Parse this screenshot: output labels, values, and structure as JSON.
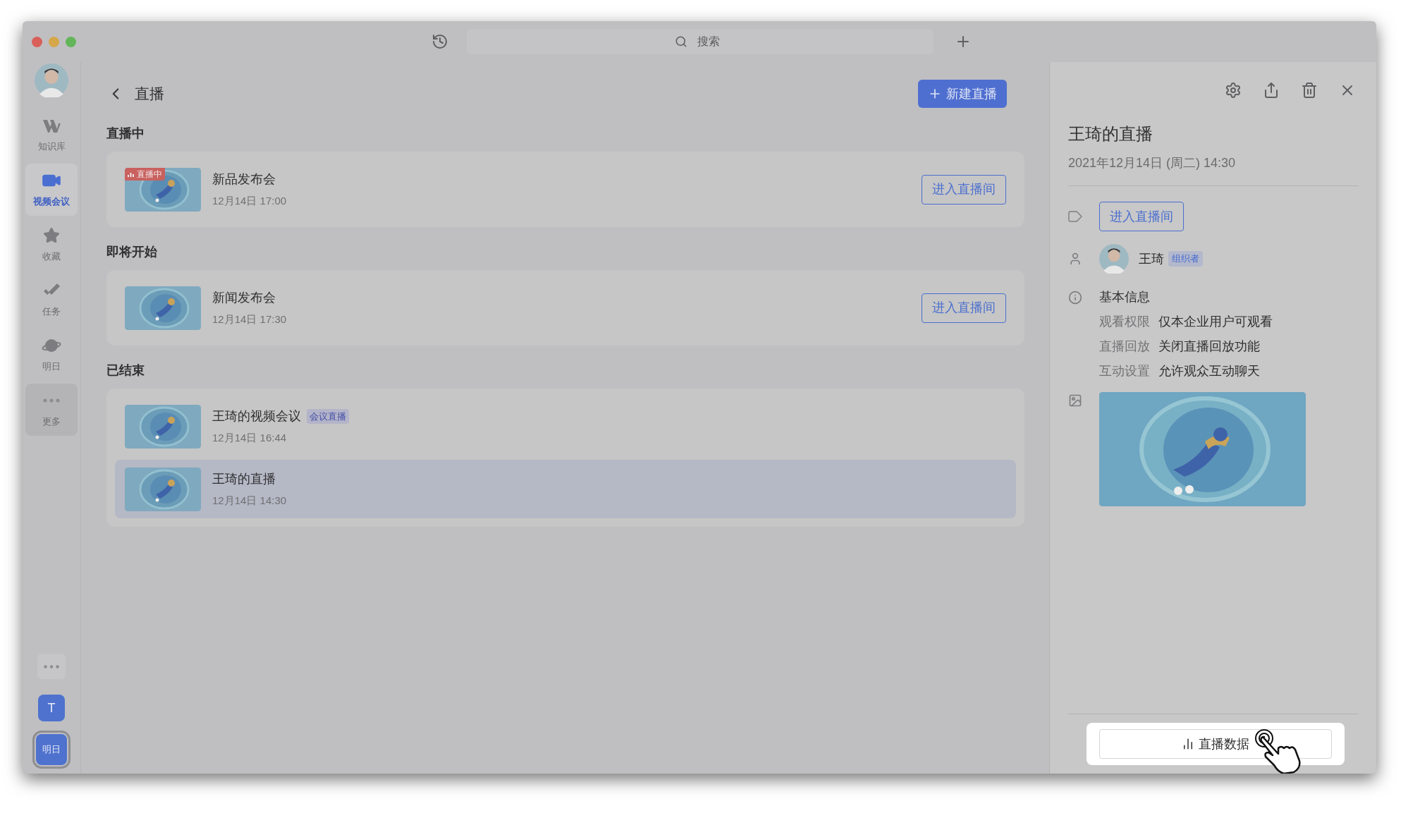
{
  "search": {
    "placeholder": "搜索"
  },
  "sidebar": {
    "items": [
      {
        "kind": "wiki",
        "label": "知识库",
        "selected": false,
        "hovered": false
      },
      {
        "kind": "video",
        "label": "视频会议",
        "selected": true,
        "hovered": false
      },
      {
        "kind": "star",
        "label": "收藏",
        "selected": false,
        "hovered": false
      },
      {
        "kind": "task",
        "label": "任务",
        "selected": false,
        "hovered": false
      },
      {
        "kind": "planet",
        "label": "明日",
        "selected": false,
        "hovered": false
      },
      {
        "kind": "more",
        "label": "更多",
        "selected": false,
        "hovered": true
      }
    ],
    "apps": [
      {
        "label": "T",
        "selected": false
      },
      {
        "label": "明日",
        "selected": true
      }
    ]
  },
  "header": {
    "title": "直播",
    "new_button": "新建直播"
  },
  "sections": [
    {
      "title": "直播中",
      "items": [
        {
          "title": "新品发布会",
          "time": "12月14日 17:00",
          "live_tag": "直播中",
          "action": "进入直播间",
          "selected": false
        }
      ]
    },
    {
      "title": "即将开始",
      "items": [
        {
          "title": "新闻发布会",
          "time": "12月14日 17:30",
          "action": "进入直播间",
          "selected": false
        }
      ]
    },
    {
      "title": "已结束",
      "items": [
        {
          "title": "王琦的视频会议",
          "tag": "会议直播",
          "time": "12月14日 16:44",
          "selected": false
        },
        {
          "title": "王琦的直播",
          "time": "12月14日 14:30",
          "selected": true
        }
      ]
    }
  ],
  "detail": {
    "title": "王琦的直播",
    "date": "2021年12月14日 (周二) 14:30",
    "enter_button": "进入直播间",
    "organizer": {
      "name": "王琦",
      "role": "组织者"
    },
    "info_title": "基本信息",
    "info": [
      {
        "label": "观看权限",
        "value": "仅本企业用户可观看"
      },
      {
        "label": "直播回放",
        "value": "关闭直播回放功能"
      },
      {
        "label": "互动设置",
        "value": "允许观众互动聊天"
      }
    ],
    "data_button": "直播数据"
  }
}
